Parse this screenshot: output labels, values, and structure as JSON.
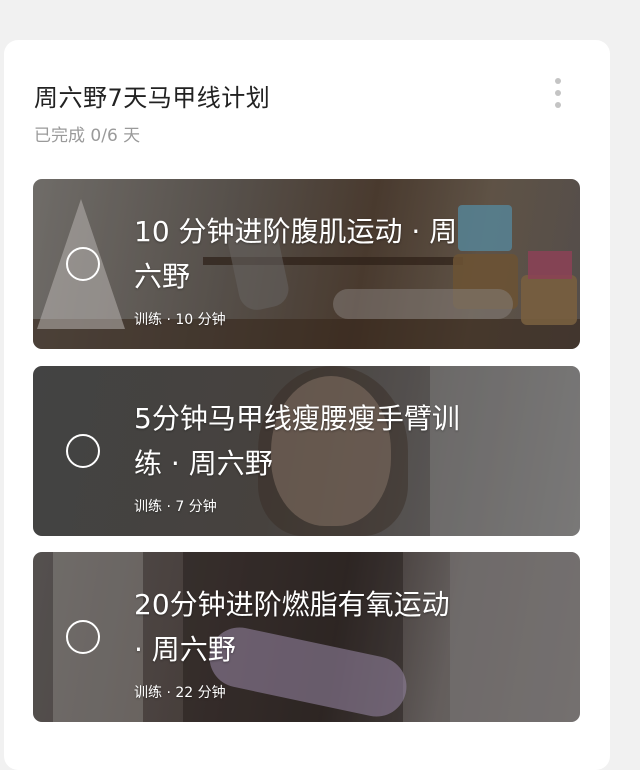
{
  "plan": {
    "title": "周六野7天马甲线计划",
    "progress": "已完成 0/6 天"
  },
  "workouts": [
    {
      "title": "10 分钟进阶腹肌运动 · 周六野",
      "meta": "训练 · 10 分钟",
      "completed": false
    },
    {
      "title": "5分钟马甲线瘦腰瘦手臂训练 · 周六野",
      "meta": "训练 · 7 分钟",
      "completed": false
    },
    {
      "title": "20分钟进阶燃脂有氧运动 · 周六野",
      "meta": "训练 · 22 分钟",
      "completed": false
    }
  ],
  "icons": {
    "menu": "more-vertical-icon",
    "check": "circle-outline-icon"
  },
  "colors": {
    "background": "#f1f1f1",
    "card": "#ffffff",
    "title": "#222222",
    "subtitle": "#9a9a9a"
  }
}
